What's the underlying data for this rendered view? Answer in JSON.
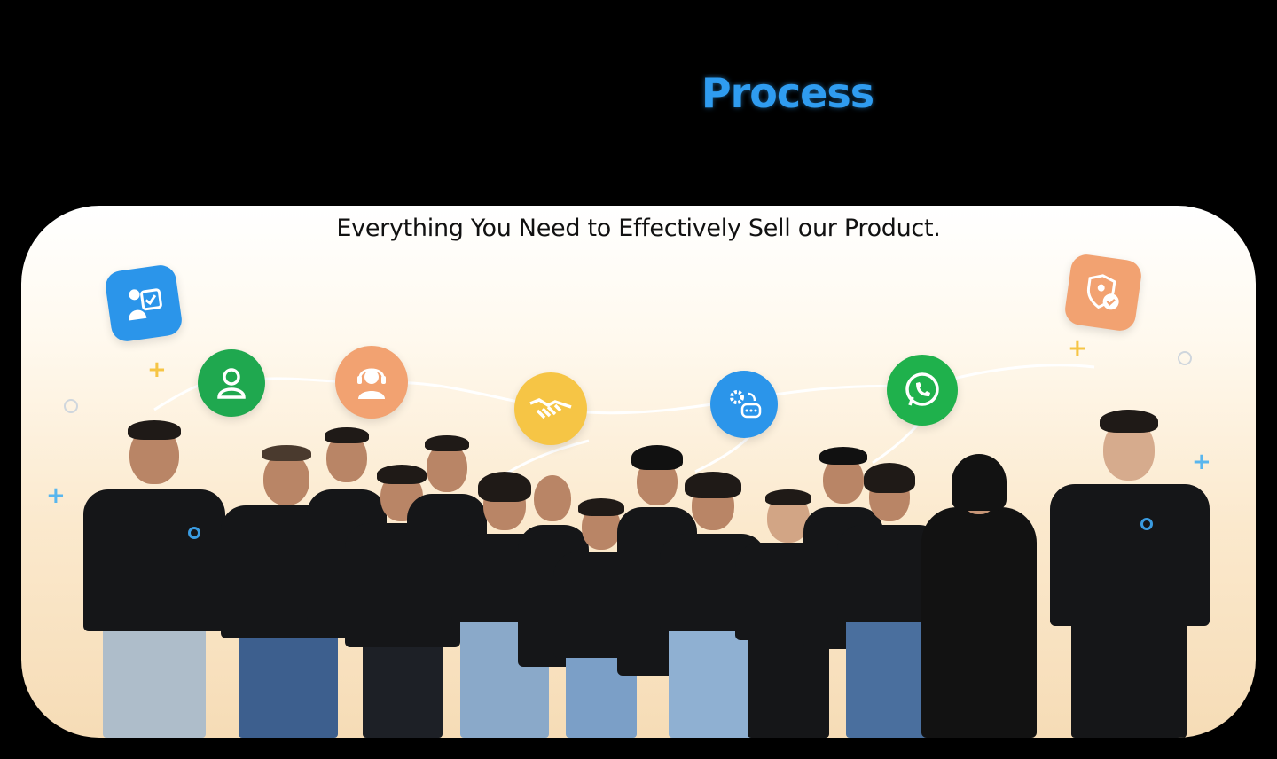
{
  "heading": {
    "accent": "Process"
  },
  "subtitle": "Everything You Need to Effectively Sell our Product.",
  "icons": [
    {
      "name": "user-checklist-icon",
      "color": "#2b95ea"
    },
    {
      "name": "user-icon",
      "color": "#1fa84f"
    },
    {
      "name": "headset-support-icon",
      "color": "#f2a271"
    },
    {
      "name": "handshake-icon",
      "color": "#f6c545"
    },
    {
      "name": "settings-chat-icon",
      "color": "#2b95ea"
    },
    {
      "name": "whatsapp-icon",
      "color": "#1fb14c"
    },
    {
      "name": "shield-check-icon",
      "color": "#f2a271"
    }
  ],
  "colors": {
    "accent": "#2f9cf0",
    "panel_top": "#ffffff",
    "panel_bottom": "#f6dcb6"
  }
}
